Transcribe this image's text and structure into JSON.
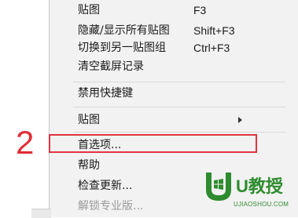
{
  "menu": {
    "items": [
      {
        "label": "贴图",
        "shortcut": "F3",
        "disabled": false
      },
      {
        "label": "隐藏/显示所有贴图",
        "shortcut": "Shift+F3",
        "disabled": false
      },
      {
        "label": "切换到另一贴图组",
        "shortcut": "Ctrl+F3",
        "disabled": false
      },
      {
        "label": "清空截屏记录",
        "shortcut": "",
        "disabled": false
      },
      {
        "label": "禁用快捷键",
        "shortcut": "",
        "disabled": false
      },
      {
        "label": "贴图",
        "shortcut": "",
        "disabled": false,
        "submenu": true
      },
      {
        "label": "首选项...",
        "shortcut": "",
        "disabled": false,
        "highlighted": true
      },
      {
        "label": "帮助",
        "shortcut": "",
        "disabled": false
      },
      {
        "label": "检查更新...",
        "shortcut": "",
        "disabled": false
      },
      {
        "label": "解锁专业版...",
        "shortcut": "",
        "disabled": true
      }
    ]
  },
  "annotation": {
    "step_number": "2",
    "color": "#e0343f"
  },
  "watermark": {
    "brand": "U教授",
    "url": "UJIAOSHOU.COM",
    "color": "#2e8b2e"
  }
}
